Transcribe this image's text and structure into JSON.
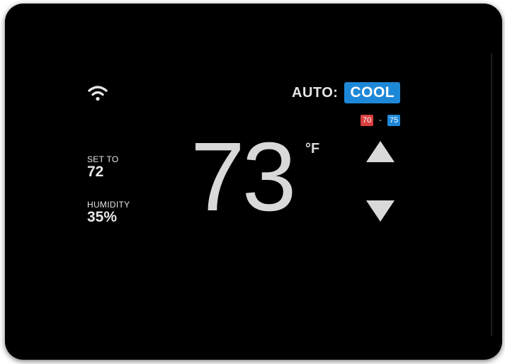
{
  "mode": {
    "label": "AUTO:",
    "value": "COOL"
  },
  "range": {
    "low": "70",
    "separator": "-",
    "high": "75"
  },
  "setpoint": {
    "label": "SET TO",
    "value": "72"
  },
  "humidity": {
    "label": "HUMIDITY",
    "value": "35%"
  },
  "temperature": {
    "current": "73",
    "unit": "°F"
  },
  "icons": {
    "wifi": "wifi-icon",
    "up": "arrow-up-icon",
    "down": "arrow-down-icon"
  },
  "colors": {
    "cool": "#1e88d8",
    "heat": "#d94040",
    "background": "#000000",
    "text": "#e6e6e6"
  }
}
